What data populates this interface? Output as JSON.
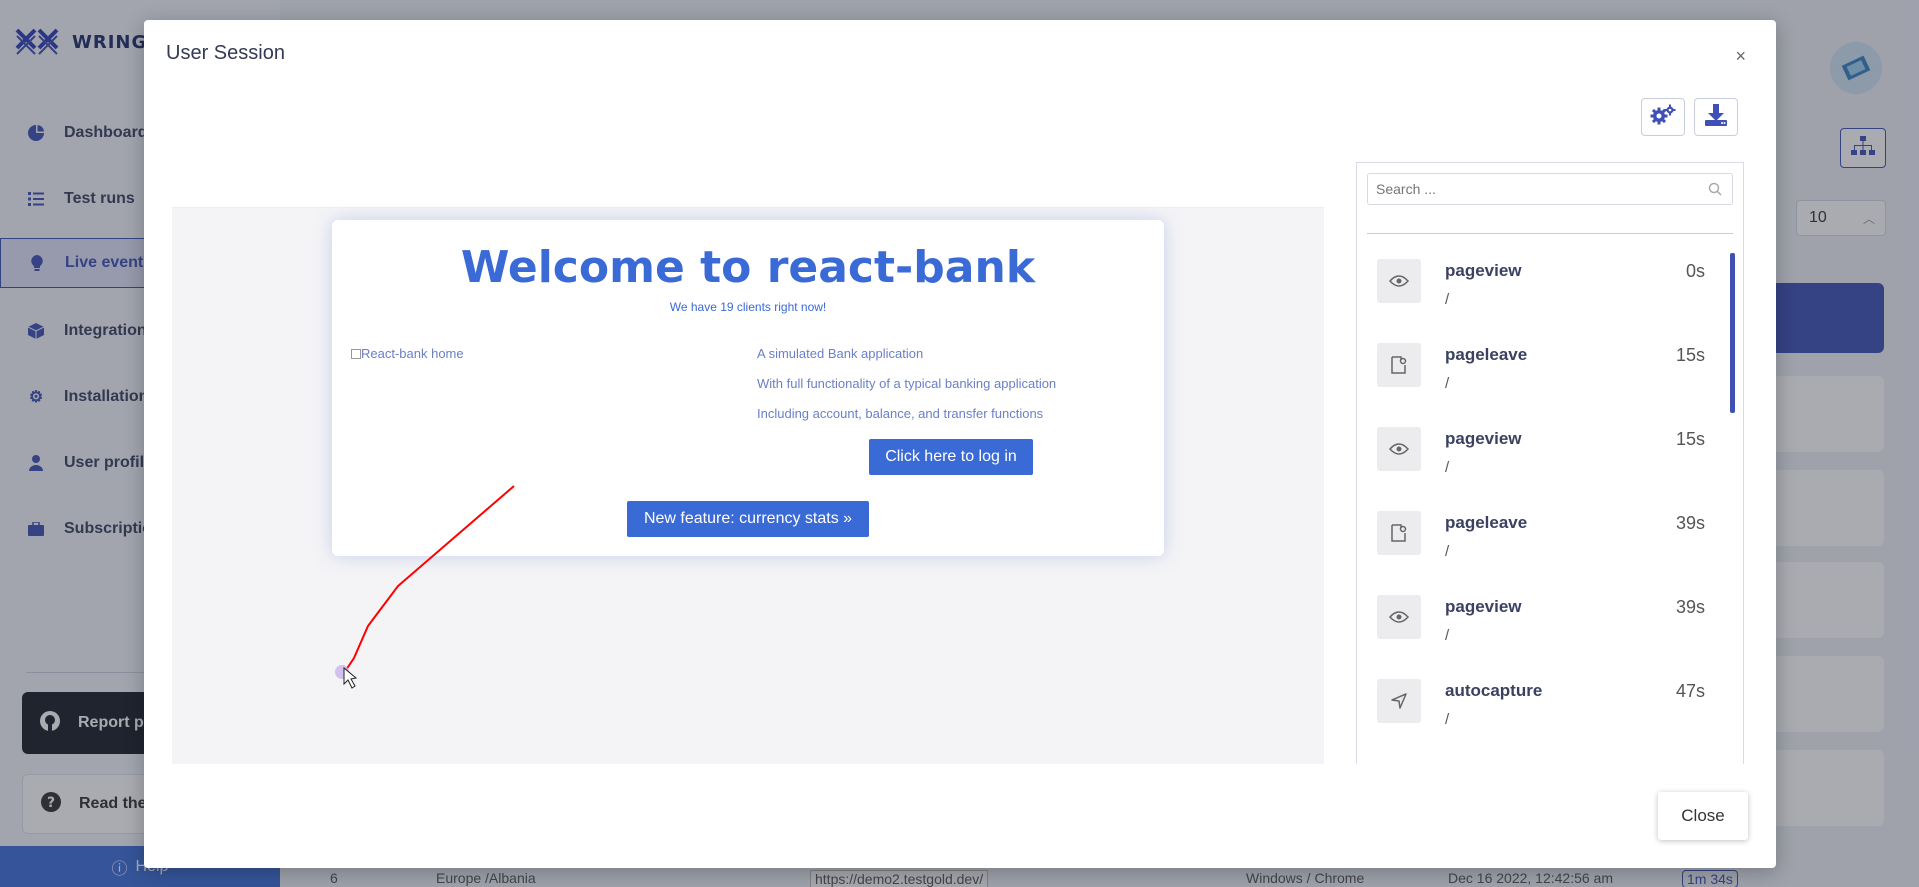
{
  "app": {
    "brand_name": "WRING",
    "nav": [
      {
        "label": "Dashboard",
        "icon": "pie-chart-icon"
      },
      {
        "label": "Test runs",
        "icon": "list-icon"
      },
      {
        "label": "Live events",
        "icon": "lightbulb-icon"
      },
      {
        "label": "Integration",
        "icon": "cube-icon"
      },
      {
        "label": "Installation",
        "icon": "gear-icon"
      },
      {
        "label": "User profile",
        "icon": "user-icon"
      },
      {
        "label": "Subscription",
        "icon": "briefcase-icon"
      }
    ],
    "report_label": "Report p",
    "read_label": "Read the",
    "help_label": "Help",
    "page_size_value": "10",
    "bg_row": {
      "index": "6",
      "location": "Europe /Albania",
      "url": "https://demo2.testgold.dev/",
      "platform": "Windows / Chrome",
      "date": "Dec 16 2022, 12:42:56 am",
      "duration": "1m 34s"
    },
    "accent_color": "#3f51b5"
  },
  "modal": {
    "title": "User Session",
    "close_x": "×",
    "close_label": "Close"
  },
  "player": {
    "heading": "Welcome to react-bank",
    "subheading": "We have 19 clients right now!",
    "img_alt": "React-bank home",
    "lines": [
      "A simulated Bank application",
      "With full functionality of a typical banking application",
      "Including account, balance, and transfer functions"
    ],
    "login_button": "Click here to log in",
    "feature_button": "New feature: currency stats »",
    "trail_color": "#ff0000",
    "brand_color": "#3a6ad6"
  },
  "events": {
    "search_placeholder": "Search ...",
    "items": [
      {
        "name": "pageview",
        "path": "/",
        "time": "0s",
        "icon": "eye-icon"
      },
      {
        "name": "pageleave",
        "path": "/",
        "time": "15s",
        "icon": "page-leave-icon"
      },
      {
        "name": "pageview",
        "path": "/",
        "time": "15s",
        "icon": "eye-icon"
      },
      {
        "name": "pageleave",
        "path": "/",
        "time": "39s",
        "icon": "page-leave-icon"
      },
      {
        "name": "pageview",
        "path": "/",
        "time": "39s",
        "icon": "eye-icon"
      },
      {
        "name": "autocapture",
        "path": "/",
        "time": "47s",
        "icon": "cursor-arrow-icon"
      }
    ]
  }
}
